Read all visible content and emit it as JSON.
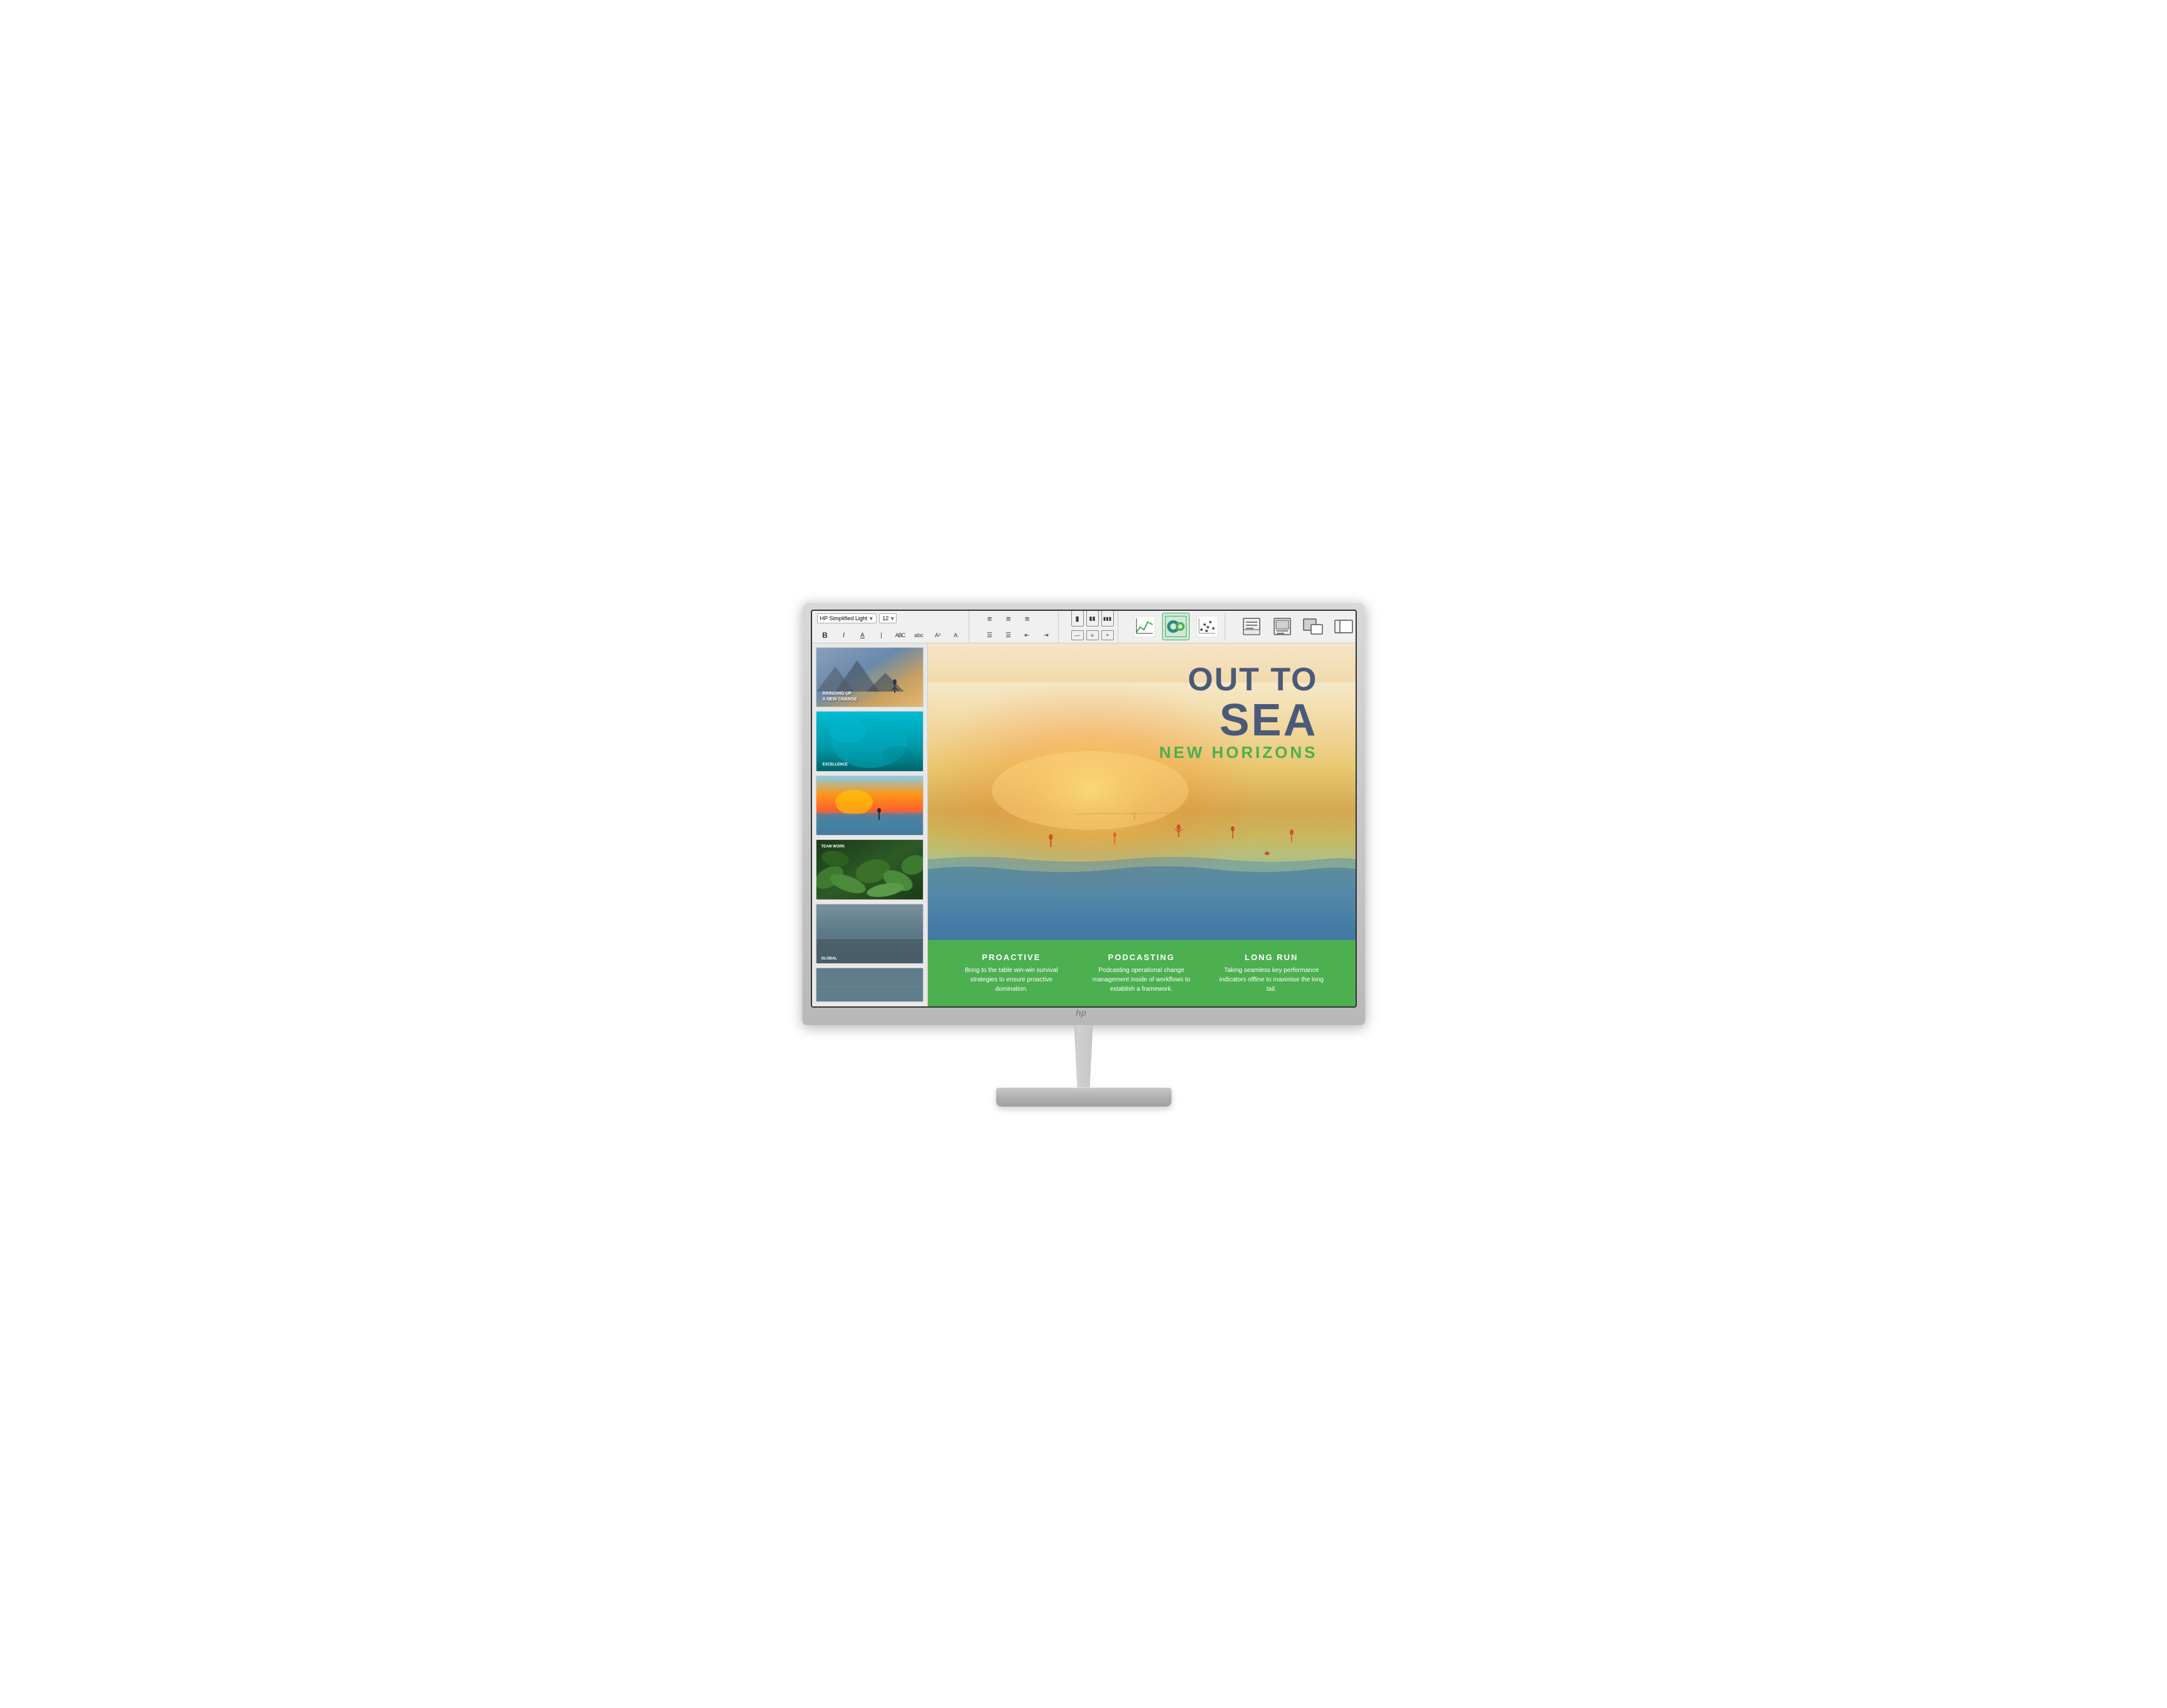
{
  "monitor": {
    "brand": "hp"
  },
  "toolbar": {
    "font_family": "HP Simplified Light",
    "font_size": "12",
    "bold": "B",
    "italic": "I",
    "underline_A": "A",
    "strikethrough": "A",
    "abc_label": "ABC",
    "abc_lower": "abc",
    "superscript": "Aˢ",
    "subscript": "A.",
    "align_left": "≡",
    "align_center": "≡",
    "align_right": "≡",
    "list_bullets": "☰",
    "list_numbers": "☰",
    "indent_left": "⇤",
    "indent_right": "⇥",
    "line_spacing": "↕",
    "columns": "▦",
    "chart_icon_label": "chart",
    "pie_icon_label": "pie",
    "scatter_icon_label": "scatter",
    "notes_icon": "notes",
    "outline_icon": "outline",
    "master_icon": "master",
    "duplicate_icon": "duplicate",
    "image_icon": "image"
  },
  "slides": {
    "slide1": {
      "title": "BRINGING UP",
      "subtitle": "A NEW CHANGE",
      "thumbnail_desc": "Mountain landscape at dusk"
    },
    "slide2": {
      "title": "EXCELLENCE",
      "thumbnail_desc": "Aerial teal ocean view"
    },
    "slide3": {
      "thumbnail_desc": "Sunset beach scene"
    },
    "slide4": {
      "title": "TEAM WORK",
      "thumbnail_desc": "Green plants close-up"
    },
    "slide5": {
      "title": "GLOBAL",
      "thumbnail_desc": "Ocean panorama"
    },
    "slide6": {
      "thumbnail_desc": "Partial slide"
    }
  },
  "main_slide": {
    "title_line1": "OUT TO",
    "title_line2": "SEA",
    "title_line3": "NEW HORIZONS",
    "col1_title": "PROACTIVE",
    "col1_text": "Bring to the table win-win survival strategies to ensure proactive domination.",
    "col2_title": "PODCASTING",
    "col2_text": "Podcasting operational change management inside of workflows to establish a framework.",
    "col3_title": "LONG RUN",
    "col3_text": "Taking seamless key performance indicators offline to maximise the long tail."
  },
  "colors": {
    "title_color": "#4a5a7a",
    "horizons_color": "#4caf50",
    "green_bar": "#4caf50",
    "text_white": "#ffffff",
    "toolbar_bg": "#f0f0f0",
    "slide_panel_bg": "#e8e8e8"
  }
}
